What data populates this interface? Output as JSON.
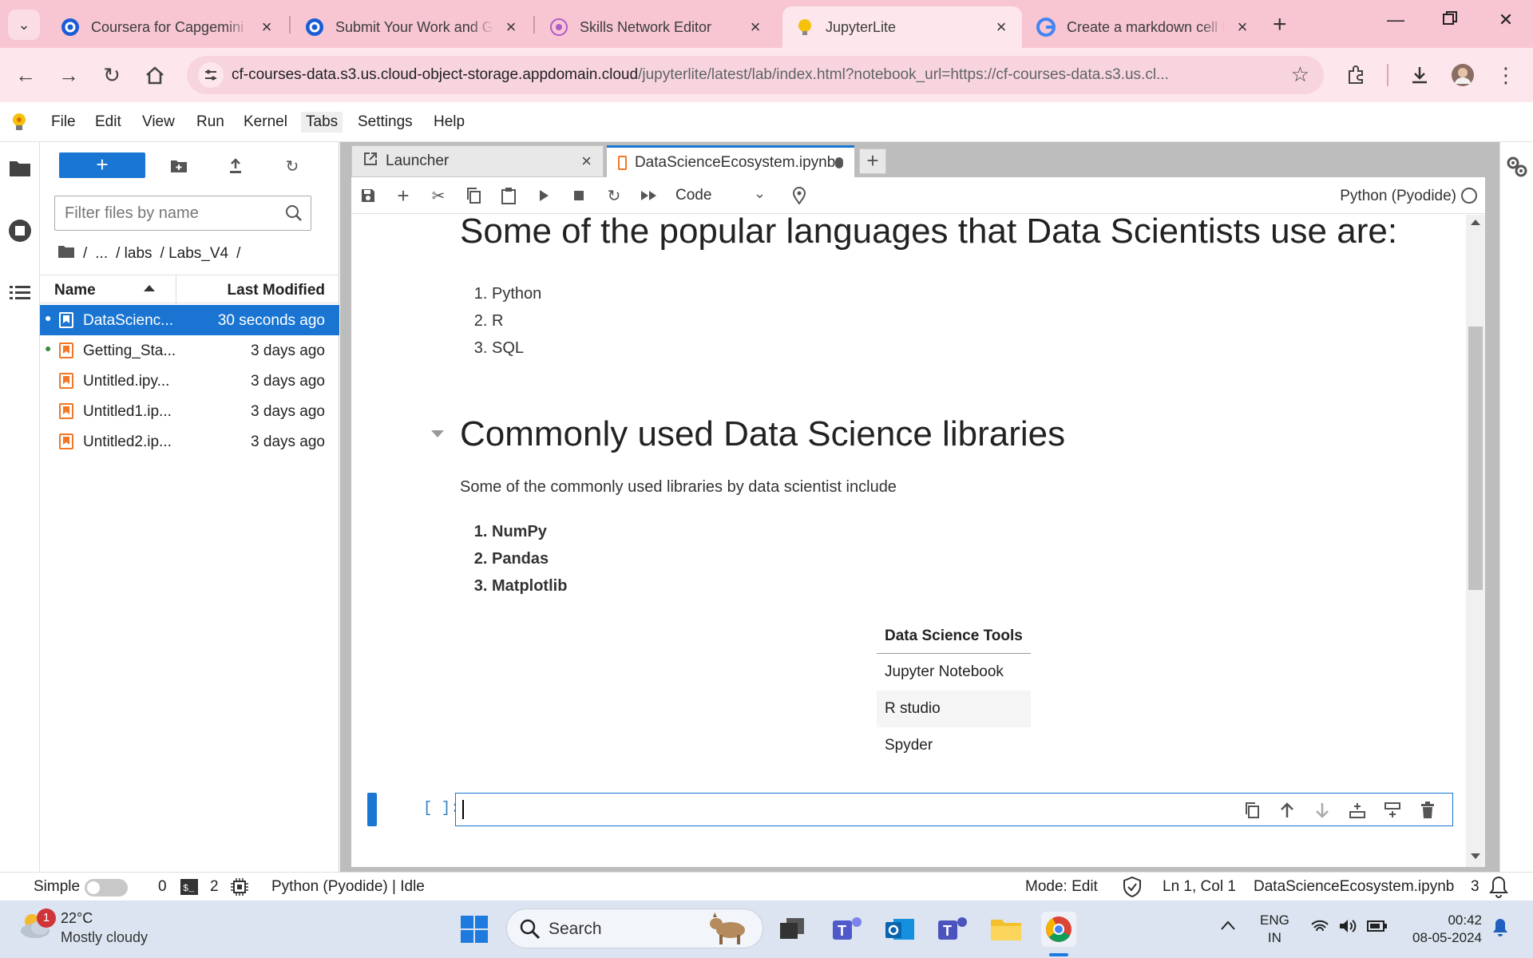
{
  "browser": {
    "tabs": [
      {
        "title": "Coursera for Capgemini |",
        "favicon": "coursera-icon"
      },
      {
        "title": "Submit Your Work and Gr",
        "favicon": "coursera-icon"
      },
      {
        "title": "Skills Network Editor",
        "favicon": "skills-network-icon"
      },
      {
        "title": "JupyterLite",
        "favicon": "jupyterlite-icon"
      },
      {
        "title": "Create a markdown cell f",
        "favicon": "google-icon"
      }
    ],
    "active_tab_index": 3,
    "url_host": "cf-courses-data.s3.us.cloud-object-storage.appdomain.cloud",
    "url_path": "/jupyterlite/latest/lab/index.html?notebook_url=https://cf-courses-data.s3.us.cl..."
  },
  "menubar": {
    "items": [
      "File",
      "Edit",
      "View",
      "Run",
      "Kernel",
      "Tabs",
      "Settings",
      "Help"
    ]
  },
  "filebrowser": {
    "new_label": "+",
    "filter_placeholder": "Filter files by name",
    "breadcrumbs": [
      "/",
      "...",
      "/ labs",
      "/ Labs_V4",
      "/"
    ],
    "columns": {
      "name": "Name",
      "modified": "Last Modified"
    },
    "files": [
      {
        "name": "DataScienc...",
        "modified": "30 seconds ago",
        "running": true,
        "selected": true
      },
      {
        "name": "Getting_Sta...",
        "modified": "3 days ago",
        "running": true,
        "selected": false
      },
      {
        "name": "Untitled.ipy...",
        "modified": "3 days ago",
        "running": false,
        "selected": false
      },
      {
        "name": "Untitled1.ip...",
        "modified": "3 days ago",
        "running": false,
        "selected": false
      },
      {
        "name": "Untitled2.ip...",
        "modified": "3 days ago",
        "running": false,
        "selected": false
      }
    ]
  },
  "dock": {
    "tabs": [
      {
        "label": "Launcher"
      },
      {
        "label": "DataScienceEcosystem.ipynb"
      }
    ],
    "add_label": "+"
  },
  "notebook": {
    "cell_type": "Code",
    "kernel": "Python (Pyodide)",
    "languages_heading": "Some of the popular languages that Data Scientists use are:",
    "languages": [
      "Python",
      "R",
      "SQL"
    ],
    "libraries_heading": "Commonly used Data Science libraries",
    "libraries_intro": "Some of the commonly used libraries by data scientist include",
    "libraries": [
      "NumPy",
      "Pandas",
      "Matplotlib"
    ],
    "tools_table": {
      "header": "Data Science Tools",
      "rows": [
        "Jupyter Notebook",
        "R studio",
        "Spyder"
      ]
    },
    "prompt": "[ ]:"
  },
  "statusbar": {
    "mode_label": "Simple",
    "terminals": "0",
    "kernels": "2",
    "kernel_status": "Python (Pyodide) | Idle",
    "mode": "Mode: Edit",
    "cursor": "Ln 1, Col 1",
    "filename": "DataScienceEcosystem.ipynb",
    "notifications": "3"
  },
  "taskbar": {
    "weather_temp": "22°C",
    "weather_cond": "Mostly cloudy",
    "weather_badge": "1",
    "search_label": "Search",
    "lang_top": "ENG",
    "lang_bottom": "IN",
    "time": "00:42",
    "date": "08-05-2024"
  },
  "colors": {
    "accent": "#1976d2",
    "browser_tabstrip": "#f7c6d2",
    "notebook_icon": "#f37726"
  }
}
